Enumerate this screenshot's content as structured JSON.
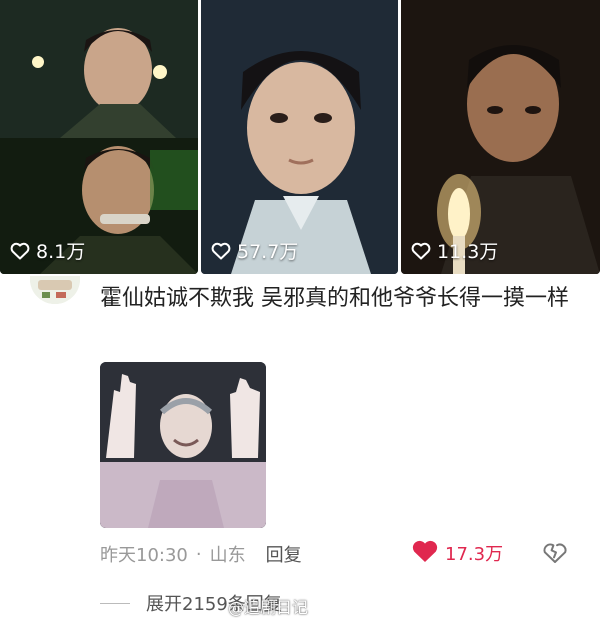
{
  "videos": [
    {
      "likes": "8.1万"
    },
    {
      "likes": "57.7万"
    },
    {
      "likes": "11.3万"
    }
  ],
  "comment": {
    "text": "霍仙姑诚不欺我 吴邪真的和他爷爷长得一摸一样",
    "time": "昨天10:30",
    "separator": "·",
    "location": "山东",
    "reply_label": "回复",
    "like_count": "17.3万",
    "expand_label": "展开2159条回复"
  },
  "watermark": "@追剧日记",
  "colors": {
    "like_red": "#e0284f",
    "meta_gray": "#999999"
  }
}
